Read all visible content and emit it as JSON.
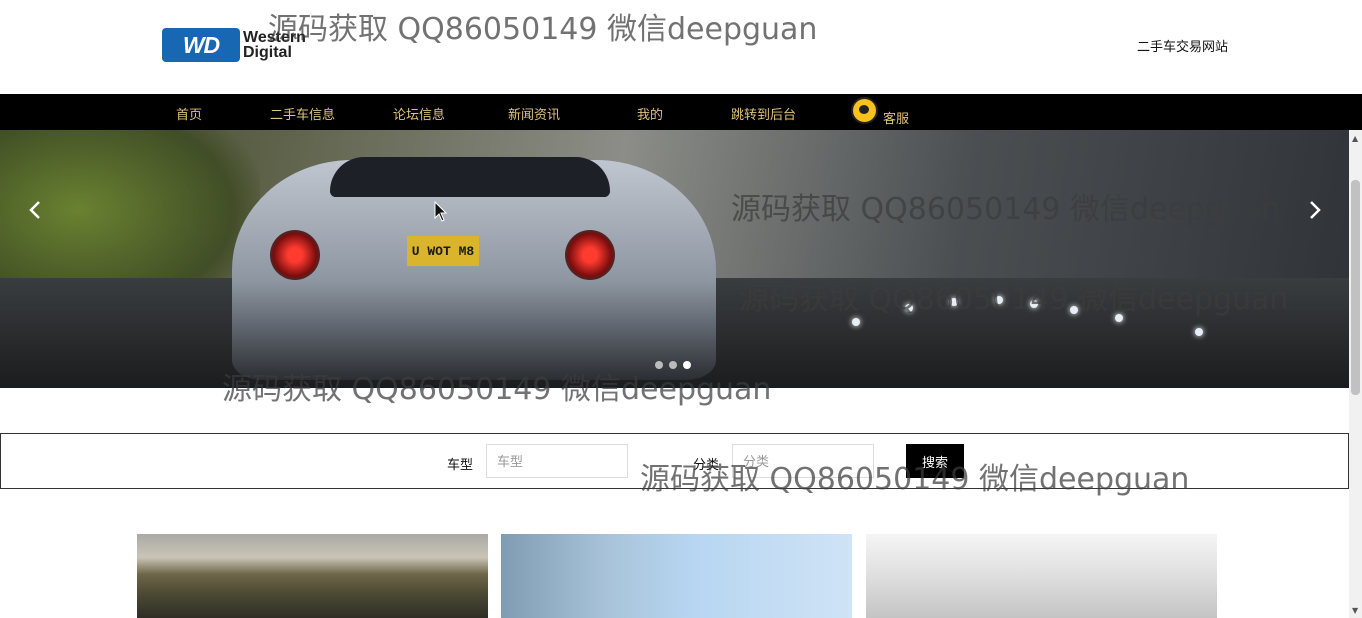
{
  "header": {
    "logo": {
      "badge": "WD",
      "line1": "Western",
      "line2": "Digital"
    },
    "site_name": "二手车交易网站"
  },
  "nav": {
    "items": [
      {
        "label": "首页"
      },
      {
        "label": "二手车信息"
      },
      {
        "label": "论坛信息"
      },
      {
        "label": "新闻资讯"
      },
      {
        "label": "我的"
      },
      {
        "label": "跳转到后台"
      },
      {
        "label": "客服"
      }
    ],
    "text_color": "#e0c27a",
    "background": "#000000"
  },
  "banner": {
    "plate_text": "U WOT M8",
    "prev_icon": "chevron-left-icon",
    "next_icon": "chevron-right-icon",
    "slide_count": 3,
    "active_slide": 3
  },
  "search": {
    "fields": [
      {
        "label": "车型",
        "placeholder": "车型",
        "value": ""
      },
      {
        "label": "分类",
        "placeholder": "分类",
        "value": ""
      }
    ],
    "button_label": "搜索"
  },
  "watermarks": [
    "源码获取 QQ86050149 微信deepguan",
    "源码获取 QQ86050149 微信deepguan",
    "源码获取 QQ86050149 微信deepguan",
    "源码获取 QQ86050149 微信deepguan",
    "源码获取 QQ86050149 微信deepguan"
  ],
  "colors": {
    "nav_bg": "#000000",
    "nav_text": "#e0c27a",
    "search_button": "#000000",
    "logo_blue": "#1767b3"
  }
}
